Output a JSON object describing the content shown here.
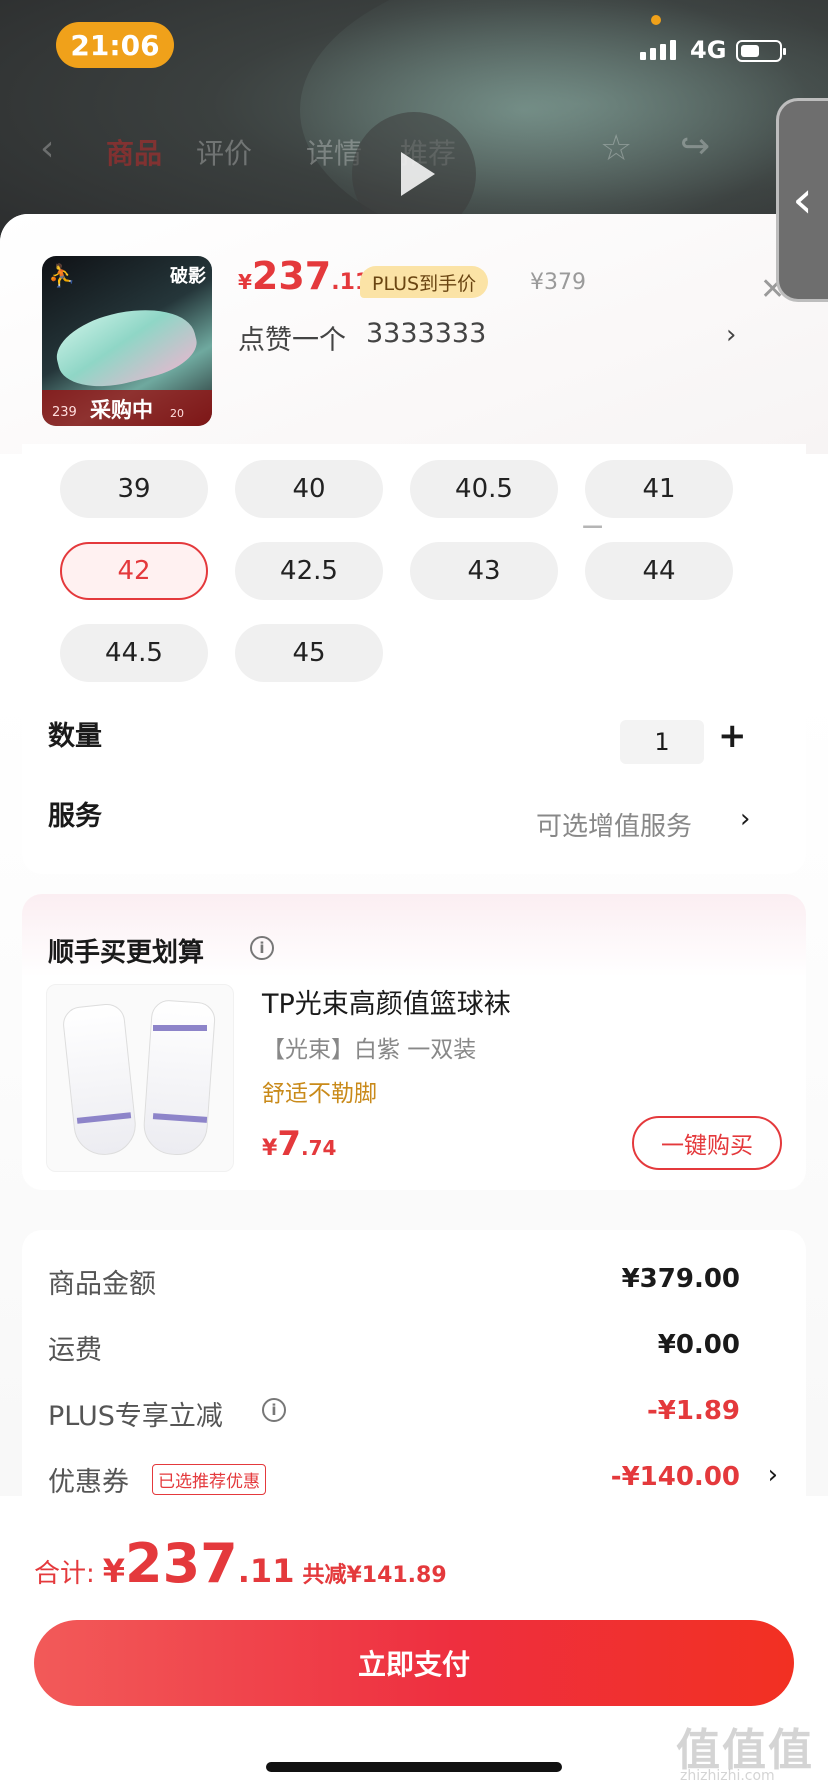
{
  "status_bar": {
    "time": "21:06",
    "network": "4G",
    "battery_level": 0.5
  },
  "nav": {
    "tabs": [
      "商品",
      "评价",
      "详情",
      "推荐"
    ]
  },
  "product": {
    "thumb_title": "破影",
    "thumb_badge": "采购中",
    "thumb_price_left": "239",
    "thumb_price_right": "20",
    "price_yen": "¥",
    "price_int": "237",
    "price_dec": ".11",
    "plus_tag": "PLUS到手价",
    "orig_price": "¥379",
    "spec_a": "点赞一个",
    "spec_b": "3333333"
  },
  "sizes": [
    "39",
    "40",
    "40.5",
    "41",
    "42",
    "42.5",
    "43",
    "44",
    "44.5",
    "45"
  ],
  "selected_size": "42",
  "quantity": {
    "label": "数量",
    "value": "1",
    "minus": "−",
    "plus": "+"
  },
  "service": {
    "label": "服务",
    "value": "可选增值服务"
  },
  "cross_sell": {
    "title": "顺手买更划算",
    "name": "TP光束高颜值篮球袜",
    "spec": "【光束】白紫 一双装",
    "feature": "舒适不勒脚",
    "price_yen": "¥",
    "price_int": "7",
    "price_dec": ".74",
    "buy_label": "一键购买"
  },
  "breakdown": {
    "goods_label": "商品金额",
    "goods_value": "¥379.00",
    "shipping_label": "运费",
    "shipping_value": "¥0.00",
    "plus_label": "PLUS专享立减",
    "plus_value": "-¥1.89",
    "coupon_label": "优惠券",
    "coupon_tag": "已选推荐优惠",
    "coupon_value": "-¥140.00"
  },
  "total": {
    "label": "合计:",
    "yen": "¥",
    "int": "237",
    "dec": ".11",
    "saved": "共减¥141.89"
  },
  "pay_label": "立即支付",
  "watermark": {
    "main": "值值值",
    "sub": "zhizhizhi.com"
  },
  "colors": {
    "accent": "#e4393c",
    "time_pill": "#f0a11a",
    "plus_tag_bg": "#fbe3a6",
    "feature": "#c98a1a"
  }
}
